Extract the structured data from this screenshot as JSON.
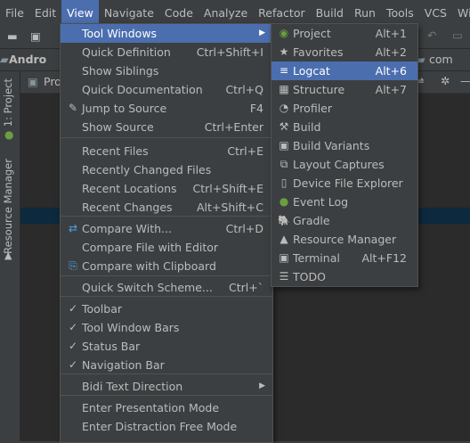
{
  "menubar": [
    "File",
    "Edit",
    "View",
    "Navigate",
    "Code",
    "Analyze",
    "Refactor",
    "Build",
    "Run",
    "Tools",
    "VCS",
    "Windo"
  ],
  "nav": {
    "project": "Andro",
    "right": "com"
  },
  "side": {
    "tab1": "1: Project",
    "tab2": "Resource Manager",
    "pane": "Pro"
  },
  "view_menu": [
    {
      "label": "Tool Windows",
      "shortcut": "",
      "sub": true
    },
    {
      "label": "Quick Definition",
      "shortcut": "Ctrl+Shift+I"
    },
    {
      "label": "Show Siblings",
      "shortcut": ""
    },
    {
      "label": "Quick Documentation",
      "shortcut": "Ctrl+Q"
    },
    {
      "label": "Jump to Source",
      "shortcut": "F4",
      "icon": "✎"
    },
    {
      "label": "Show Source",
      "shortcut": "Ctrl+Enter"
    },
    {
      "label": "Recent Files",
      "shortcut": "Ctrl+E"
    },
    {
      "label": "Recently Changed Files",
      "shortcut": ""
    },
    {
      "label": "Recent Locations",
      "shortcut": "Ctrl+Shift+E"
    },
    {
      "label": "Recent Changes",
      "shortcut": "Alt+Shift+C"
    },
    {
      "label": "Compare With...",
      "shortcut": "Ctrl+D",
      "icon": "⇄"
    },
    {
      "label": "Compare File with Editor",
      "shortcut": ""
    },
    {
      "label": "Compare with Clipboard",
      "shortcut": "",
      "icon": "⎘"
    },
    {
      "label": "Quick Switch Scheme...",
      "shortcut": "Ctrl+`"
    },
    {
      "label": "Toolbar",
      "shortcut": "",
      "icon": "✓"
    },
    {
      "label": "Tool Window Bars",
      "shortcut": "",
      "icon": "✓"
    },
    {
      "label": "Status Bar",
      "shortcut": "",
      "icon": "✓"
    },
    {
      "label": "Navigation Bar",
      "shortcut": "",
      "icon": "✓"
    },
    {
      "label": "Bidi Text Direction",
      "shortcut": "",
      "sub": true
    },
    {
      "label": "Enter Presentation Mode",
      "shortcut": ""
    },
    {
      "label": "Enter Distraction Free Mode",
      "shortcut": ""
    }
  ],
  "tool_windows": [
    {
      "label": "Project",
      "shortcut": "Alt+1",
      "icon": "◉"
    },
    {
      "label": "Favorites",
      "shortcut": "Alt+2",
      "icon": "★"
    },
    {
      "label": "Logcat",
      "shortcut": "Alt+6",
      "icon": "≡"
    },
    {
      "label": "Structure",
      "shortcut": "Alt+7",
      "icon": "▦"
    },
    {
      "label": "Profiler",
      "shortcut": "",
      "icon": "◔"
    },
    {
      "label": "Build",
      "shortcut": "",
      "icon": "⚒"
    },
    {
      "label": "Build Variants",
      "shortcut": "",
      "icon": "▣"
    },
    {
      "label": "Layout Captures",
      "shortcut": "",
      "icon": "⧉"
    },
    {
      "label": "Device File Explorer",
      "shortcut": "",
      "icon": "▯"
    },
    {
      "label": "Event Log",
      "shortcut": "",
      "icon": "●"
    },
    {
      "label": "Gradle",
      "shortcut": "",
      "icon": "🐘"
    },
    {
      "label": "Resource Manager",
      "shortcut": "",
      "icon": "▲"
    },
    {
      "label": "Terminal",
      "shortcut": "Alt+F12",
      "icon": "▣"
    },
    {
      "label": "TODO",
      "shortcut": "",
      "icon": "☰"
    }
  ]
}
